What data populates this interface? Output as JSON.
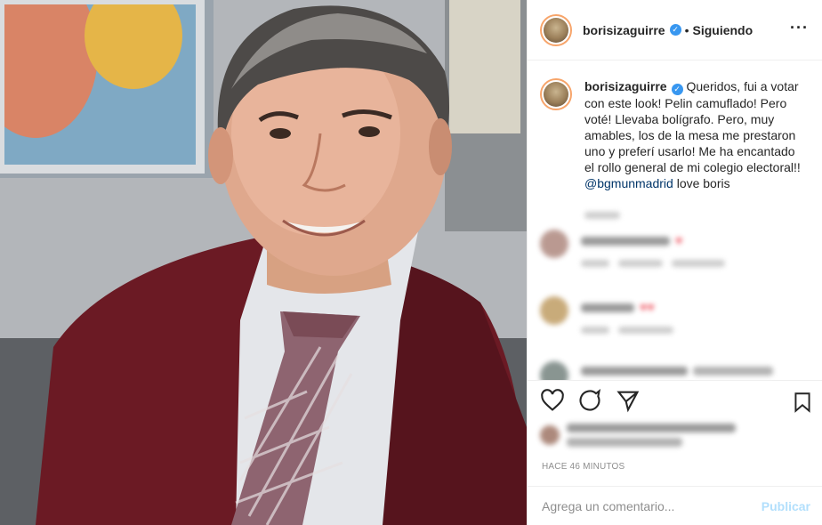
{
  "post": {
    "username": "borisizaguirre",
    "separator": "•",
    "follow_label": "Siguiendo",
    "more_icon": "more-horizontal-icon",
    "verified_icon": "verified-badge-icon",
    "caption": {
      "username": "borisizaguirre",
      "text": " Queridos, fui a votar con este look! Pelin camuflado! Pero voté! Llevaba bolígrafo. Pero, muy amables, los de la mesa me prestaron uno y preferí usarlo! Me ha encantado el rollo general de mi colegio electoral!! ",
      "mention": "@bgmunmadrid",
      "tail": " love boris"
    },
    "timestamp": "HACE 46 MINUTOS",
    "comment_input": {
      "placeholder": "Agrega un comentario..."
    },
    "publish_label": "Publicar"
  },
  "colors": {
    "accent_link": "#003569",
    "verified": "#3897f0",
    "publish_disabled": "#b2dffc",
    "heart": "#ed4956",
    "sweater": "#6b1a24"
  },
  "icons": [
    "heart-icon",
    "comment-icon",
    "share-icon",
    "bookmark-icon"
  ]
}
